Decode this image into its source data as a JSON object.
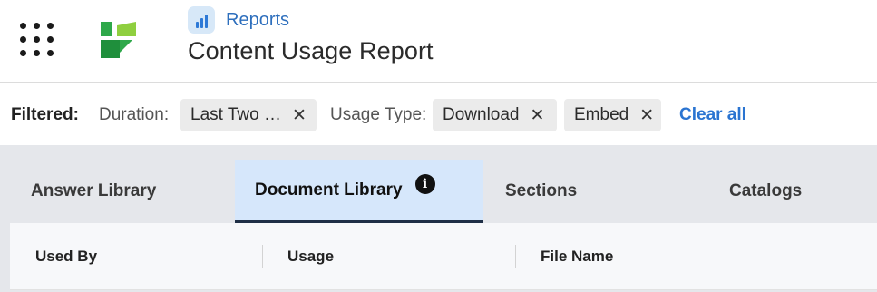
{
  "header": {
    "breadcrumb_label": "Reports",
    "page_title": "Content Usage Report",
    "breadcrumb_icon": "bar-chart-icon",
    "app_switcher_icon": "grid-dots-icon",
    "logo_icon": "brand-logo-icon",
    "brand_colors": [
      "#2ea84a",
      "#8fcf3f",
      "#1f8f3c"
    ]
  },
  "filters": {
    "label": "Filtered:",
    "duration_label": "Duration:",
    "duration_value": "Last Two …",
    "usage_type_label": "Usage Type:",
    "usage_types": [
      "Download",
      "Embed"
    ],
    "remove_glyph": "✕",
    "clear_all": "Clear all",
    "accent": "#2a74d1"
  },
  "tabs": [
    {
      "label": "Answer Library",
      "active": false
    },
    {
      "label": "Document Library",
      "active": true,
      "info_glyph": "i"
    },
    {
      "label": "Sections",
      "active": false
    },
    {
      "label": "Catalogs",
      "active": false
    }
  ],
  "table": {
    "columns": [
      "Used By",
      "Usage",
      "File Name"
    ]
  }
}
